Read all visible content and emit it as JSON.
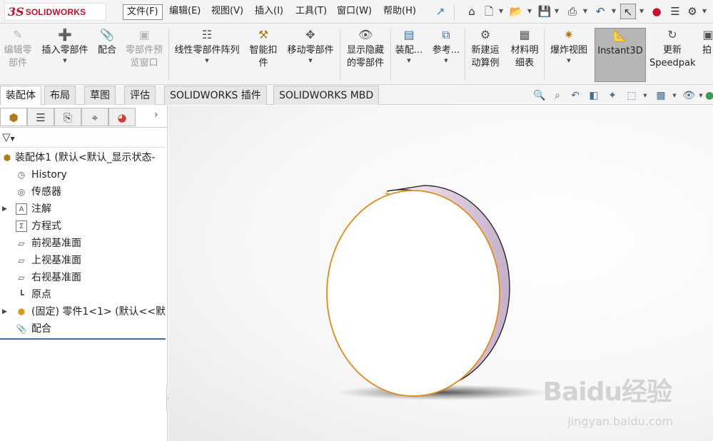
{
  "app": {
    "logo_ds": "3S",
    "logo_name": "SOLIDWORKS"
  },
  "menu": [
    "文件(F)",
    "编辑(E)",
    "视图(V)",
    "插入(I)",
    "工具(T)",
    "窗口(W)",
    "帮助(H)"
  ],
  "quick_access": [
    "home-icon",
    "new-document-icon",
    "open-icon",
    "save-icon",
    "print-icon",
    "undo-icon",
    "select-cursor-icon",
    "rebuild-traffic-light-icon",
    "options-gear-icon"
  ],
  "ribbon": {
    "edit_component": "编辑零部件",
    "insert_component": "插入零部件",
    "mate": "配合",
    "component_preview": "零部件预览窗口",
    "linear_pattern": "线性零部件阵列",
    "smart_fasteners": "智能扣件",
    "move_component": "移动零部件",
    "show_hidden": "显示隐藏的零部件",
    "assembly_features": "装配...",
    "reference": "参考...",
    "new_motion": "新建运动算例",
    "bom": "材料明细表",
    "exploded_view": "爆炸视图",
    "instant3d": "Instant3D",
    "update_speedpak": "更新Speedpak",
    "more": "拍"
  },
  "tabs": [
    "装配体",
    "布局",
    "草图",
    "评估",
    "SOLIDWORKS 插件",
    "SOLIDWORKS MBD"
  ],
  "view_tools": [
    "zoom-to-fit-icon",
    "zoom-area-icon",
    "previous-view-icon",
    "section-view-icon",
    "dynamic-annotation-icon",
    "view-orientation-icon",
    "display-style-icon",
    "hide-show-icon",
    "appearance-icon"
  ],
  "tree": {
    "root": "装配体1 (默认<默认_显示状态-",
    "items": {
      "history": "History",
      "sensors": "传感器",
      "annotations": "注解",
      "equations": "方程式",
      "front_plane": "前视基准面",
      "top_plane": "上视基准面",
      "right_plane": "右视基准面",
      "origin": "原点",
      "part": "(固定) 零件1<1> (默认<<默",
      "mates": "配合"
    }
  },
  "watermark": {
    "brand": "Baidu经验",
    "url": "jingyan.baidu.com"
  },
  "colors": {
    "accent_selected": "#c8102e",
    "edge_highlight": "#e08a1e",
    "disc_side": "#c9b7cc"
  }
}
